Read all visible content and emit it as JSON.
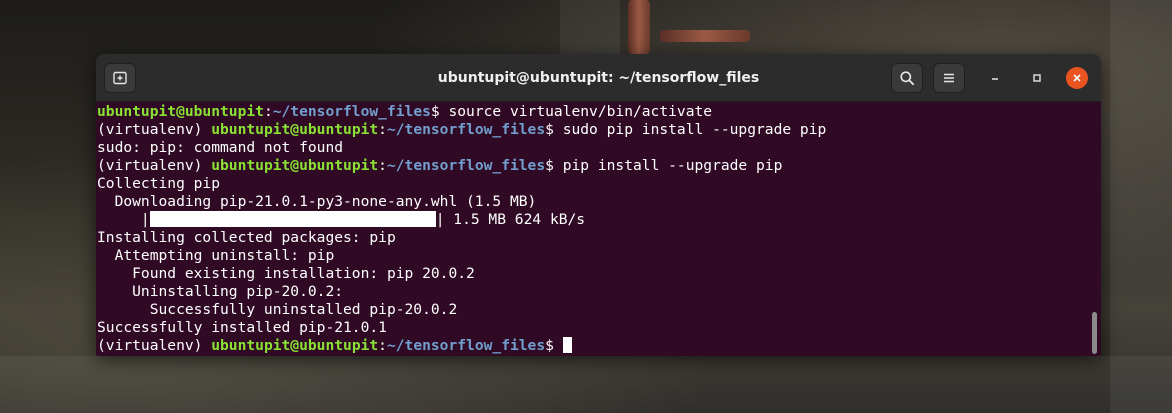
{
  "window": {
    "title": "ubuntupit@ubuntupit: ~/tensorflow_files",
    "accent_close": "#e95420"
  },
  "icons": {
    "new_tab": "new-tab-icon",
    "search": "search-icon",
    "menu": "hamburger-menu-icon",
    "minimize": "minimize-icon",
    "maximize": "maximize-icon",
    "close": "close-icon"
  },
  "colors": {
    "terminal_bg": "#300a24",
    "user_host": "#8ae234",
    "path": "#729fcf",
    "text": "#ffffff"
  },
  "terminal": {
    "user": "ubuntupit@ubuntupit",
    "sep": ":",
    "path": "~/tensorflow_files",
    "prompt_end": "$ ",
    "venv": "(virtualenv) ",
    "cmd1": "source virtualenv/bin/activate",
    "cmd2": "sudo pip install --upgrade pip",
    "out_sudo": "sudo: pip: command not found",
    "cmd3": "pip install --upgrade pip",
    "out_collecting": "Collecting pip",
    "out_downloading": "  Downloading pip-21.0.1-py3-none-any.whl (1.5 MB)",
    "progress_prefix": "     |",
    "progress_suffix": "| 1.5 MB 624 kB/s",
    "out_installing": "Installing collected packages: pip",
    "out_attempting": "  Attempting uninstall: pip",
    "out_found": "    Found existing installation: pip 20.0.2",
    "out_uninstalling": "    Uninstalling pip-20.0.2:",
    "out_success_un": "      Successfully uninstalled pip-20.0.2",
    "out_success_in": "Successfully installed pip-21.0.1"
  }
}
